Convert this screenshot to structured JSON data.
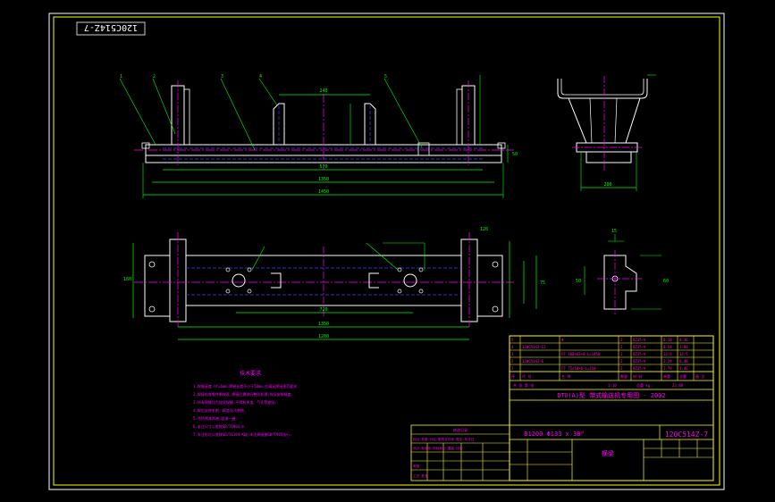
{
  "colors": {
    "background": "#000000",
    "outer_frame": "#ffffff",
    "drawing_frame": "#ffff00",
    "outline": "#ffffff",
    "dimension": "#00ff00",
    "centerline": "#ff00ff",
    "hidden": "#4040ff",
    "text_magenta": "#ff00ff",
    "text_yellow": "#ffff00",
    "leader": "#ffff00"
  },
  "drawing_number_rotated": "120C514Z-7",
  "title_block": {
    "title": "DTⅡ(A)型  带式输送机专用图 - 2002",
    "drawing_number": "120C514Z-7",
    "spec": "B1200 Φ133 x 38°",
    "name": "横梁",
    "header_labels": [
      "序",
      "代 号",
      "名 称",
      "数量",
      "材 料",
      "单重",
      "总重",
      "备 注"
    ],
    "bom": [
      {
        "no": "5",
        "code": "",
        "name": "Φ",
        "qty": "2",
        "mat": "Q235-A",
        "w1": "0.18",
        "w2": "0.36"
      },
      {
        "no": "4",
        "code": "120C514Z-12",
        "name": "",
        "qty": "2",
        "mat": "Q235-A",
        "w1": "0.54",
        "w2": "1.08"
      },
      {
        "no": "3",
        "code": "",
        "name": "FF 100×63×8 L=1450",
        "qty": "1",
        "mat": "Q235-A",
        "w1": "12.5",
        "w2": "12.5"
      },
      {
        "no": "2",
        "code": "120C514Z-6",
        "name": "",
        "qty": "2",
        "mat": "Q235-A",
        "w1": "3.24",
        "w2": "6.48"
      },
      {
        "no": "1",
        "code": "",
        "name": "FF 75×50×6 L=350",
        "qty": "2",
        "mat": "Q235-A",
        "w1": "1.73",
        "w2": "3.46"
      }
    ],
    "weight_label": "总重 kg",
    "weight_value": "23.88",
    "row_scale": "1:10",
    "row_sheet": "共 张 第 张"
  },
  "tech_requirements": {
    "heading": "技术要求",
    "lines": [
      "1.焊缝高度 hf=6mm,焊缝长度不小于50mm,应满足焊接规范要求.",
      "2.焊接前各零件需校直,焊接后需进行整形处理,保证安装精度.",
      "3.所有焊缝均为连续焊缝,不得有夹渣、气孔等缺陷.",
      "4.焊后去除毛刺、焊渣及飞溅物.",
      "5.涂防锈漆两遍,面漆一遍.",
      "6.未注尺寸公差按GB/T1804-m.",
      "7.未注形位公差按GB/T1184-K级,未注焊接按GB/T985执行."
    ]
  },
  "revision_block": {
    "header": "修改记录",
    "lines": [
      "标记 处数 分区 更改文件号 签名 年月日",
      "设计 标准化 阶段标记 重量 比例",
      "审核",
      "工艺 批准"
    ]
  },
  "dimensions": {
    "front_top": "240",
    "front_a": "570",
    "front_b": "1350",
    "front_c": "1450",
    "front_mid": "50",
    "side_w": "200",
    "plan_a": "720",
    "plan_b": "1350",
    "plan_c": "1200",
    "plan_h": "160",
    "plan_r": "120",
    "plan_s": "75",
    "detail_a": "15",
    "detail_b": "60",
    "detail_c": "50"
  },
  "balloons": [
    "1",
    "2",
    "3",
    "4",
    "5"
  ]
}
